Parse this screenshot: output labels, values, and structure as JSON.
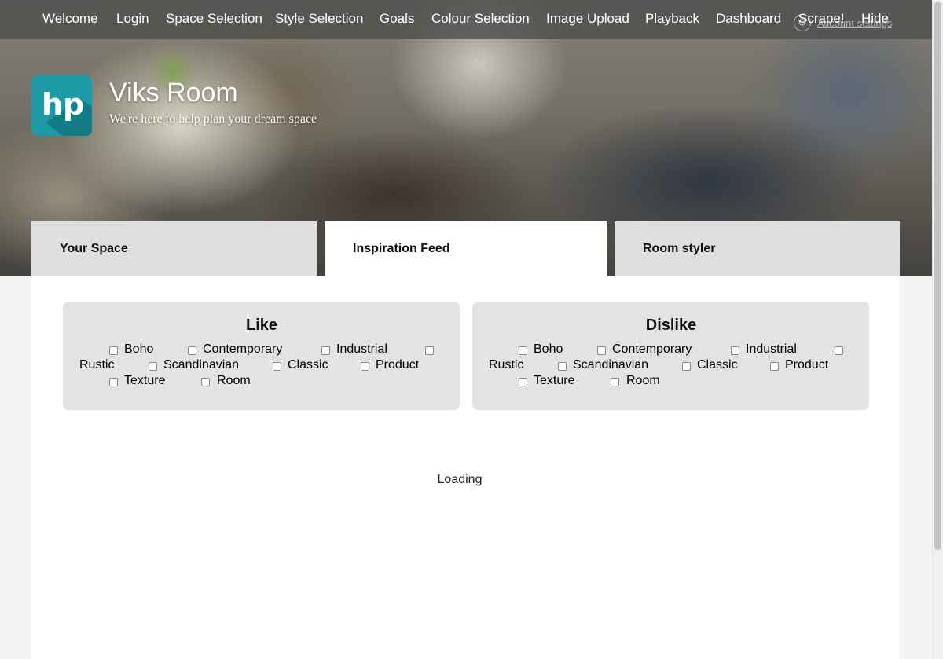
{
  "nav": {
    "items": [
      "Welcome",
      "Login",
      "Space Selection",
      "Style Selection",
      "Goals",
      "Colour Selection",
      "Image Upload",
      "Playback",
      "Dashboard",
      "Scrape!",
      "Hide"
    ],
    "account_label": "Account settings"
  },
  "brand": {
    "logo_text": "hp",
    "title": "Viks Room",
    "subtitle": "We're here to help plan your dream space"
  },
  "tabs": [
    {
      "label": "Your Space",
      "active": false
    },
    {
      "label": "Inspiration Feed",
      "active": true
    },
    {
      "label": "Room styler",
      "active": false
    }
  ],
  "like": {
    "title": "Like",
    "options": [
      "Boho",
      "Contemporary",
      "Industrial",
      "Rustic",
      "Scandinavian",
      "Classic",
      "Product",
      "Texture",
      "Room"
    ]
  },
  "dislike": {
    "title": "Dislike",
    "options": [
      "Boho",
      "Contemporary",
      "Industrial",
      "Rustic",
      "Scandinavian",
      "Classic",
      "Product",
      "Texture",
      "Room"
    ]
  },
  "status": {
    "loading": "Loading"
  },
  "colors": {
    "accent": "#1d9aa6",
    "tab_inactive": "#dedede",
    "panel": "#e3e3e3"
  }
}
